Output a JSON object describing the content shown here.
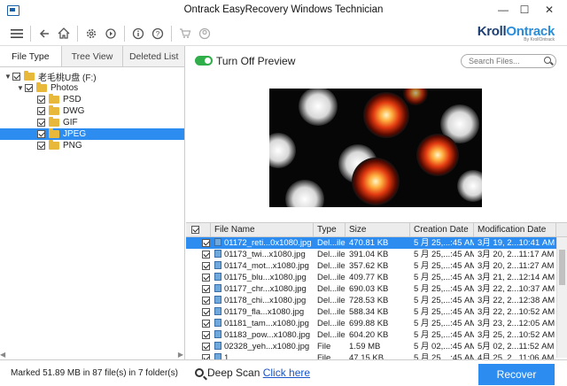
{
  "window": {
    "title": "Ontrack EasyRecovery Windows Technician",
    "minimize": "—",
    "maximize": "☐",
    "close": "✕"
  },
  "logo": {
    "brand_a": "Kroll",
    "brand_b": "Ontrack",
    "sub": "By KrollOntrack"
  },
  "toolbar": {
    "icons": [
      "menu-icon",
      "back-icon",
      "home-icon",
      "settings-icon",
      "refresh-icon",
      "info-icon",
      "help-icon",
      "cart-icon",
      "account-icon"
    ]
  },
  "tabs": [
    "File Type",
    "Tree View",
    "Deleted List"
  ],
  "tree": [
    {
      "label": "老毛桃U盘 (F:)",
      "level": 0,
      "expander": "▼",
      "folder": true
    },
    {
      "label": "Photos",
      "level": 1,
      "expander": "▼",
      "folder": true
    },
    {
      "label": "PSD",
      "level": 2,
      "expander": "",
      "folder": true
    },
    {
      "label": "DWG",
      "level": 2,
      "expander": "",
      "folder": true
    },
    {
      "label": "GIF",
      "level": 2,
      "expander": "",
      "folder": true
    },
    {
      "label": "JPEG",
      "level": 2,
      "expander": "",
      "folder": true,
      "selected": true
    },
    {
      "label": "PNG",
      "level": 2,
      "expander": "",
      "folder": true
    }
  ],
  "preview": {
    "label": "Turn Off Preview",
    "search_placeholder": "Search Files..."
  },
  "grid": {
    "columns": [
      "File Name",
      "Type",
      "Size",
      "Creation Date",
      "Modification Date"
    ],
    "rows": [
      [
        "01172_reti...0x1080.jpg",
        "Del...ile",
        "470.81 KB",
        "5 月 25,...:45 AM",
        "3月 19, 2...10:41 AM"
      ],
      [
        "01173_twi...x1080.jpg",
        "Del...ile",
        "391.04 KB",
        "5 月 25,...:45 AM",
        "3月 20, 2...11:17 AM"
      ],
      [
        "01174_mot...x1080.jpg",
        "Del...ile",
        "357.62 KB",
        "5 月 25,...:45 AM",
        "3月 20, 2...11:27 AM"
      ],
      [
        "01175_blu...x1080.jpg",
        "Del...ile",
        "409.77 KB",
        "5 月 25,...:45 AM",
        "3月 21, 2...12:14 AM"
      ],
      [
        "01177_chr...x1080.jpg",
        "Del...ile",
        "690.03 KB",
        "5 月 25,...:45 AM",
        "3月 22, 2...10:37 AM"
      ],
      [
        "01178_chi...x1080.jpg",
        "Del...ile",
        "728.53 KB",
        "5 月 25,...:45 AM",
        "3月 22, 2...12:38 AM"
      ],
      [
        "01179_fla...x1080.jpg",
        "Del...ile",
        "588.34 KB",
        "5 月 25,...:45 AM",
        "3月 22, 2...10:52 AM"
      ],
      [
        "01181_tam...x1080.jpg",
        "Del...ile",
        "699.88 KB",
        "5 月 25,...:45 AM",
        "3月 23, 2...12:05 AM"
      ],
      [
        "01183_pow...x1080.jpg",
        "Del...ile",
        "604.20 KB",
        "5 月 25,...:45 AM",
        "3月 25, 2...10:52 AM"
      ],
      [
        "02328_yeh...x1080.jpg",
        "File",
        "1.59 MB",
        "5 月 02,...:45 AM",
        "5月 02, 2...11:52 AM"
      ],
      [
        "1...",
        "File",
        "47.15 KB",
        "5 月 25,...:45 AM",
        "4月 25, 2...11:06 AM"
      ]
    ]
  },
  "status": {
    "marked": "Marked 51.89 MB in 87 file(s) in 7 folder(s)",
    "deep_scan": "Deep Scan",
    "click_here": "Click here",
    "recover": "Recover"
  }
}
